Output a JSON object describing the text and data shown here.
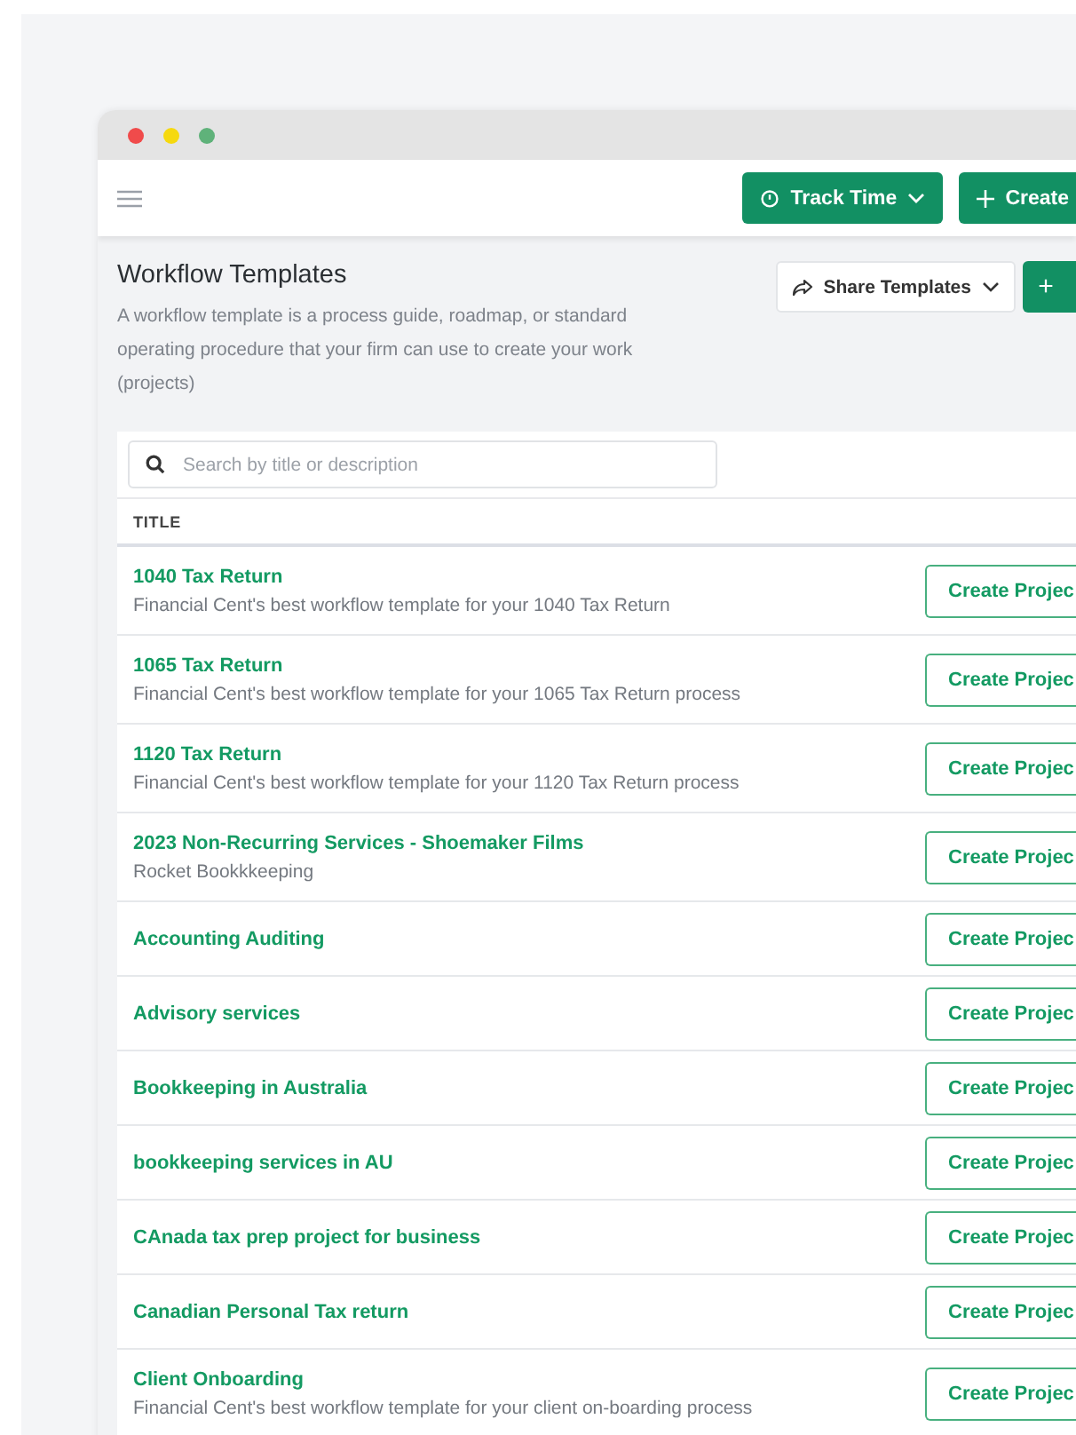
{
  "header": {
    "track_time": "Track Time",
    "create": "Create"
  },
  "page": {
    "title": "Workflow Templates",
    "description": "A workflow template is a process guide, roadmap, or standard operating procedure that your firm can use to create your work (projects)",
    "share": "Share Templates",
    "add": "+"
  },
  "search": {
    "placeholder": "Search by title or description"
  },
  "table": {
    "columns": [
      "TITLE"
    ],
    "rows": [
      {
        "title": "1040 Tax Return",
        "description": "Financial Cent's best workflow template for your 1040 Tax Return",
        "action": "Create Projec"
      },
      {
        "title": "1065 Tax Return",
        "description": "Financial Cent's best workflow template for your 1065 Tax Return process",
        "action": "Create Projec"
      },
      {
        "title": "1120 Tax Return",
        "description": "Financial Cent's best workflow template for your 1120 Tax Return process",
        "action": "Create Projec"
      },
      {
        "title": "2023 Non-Recurring Services - Shoemaker Films",
        "description": "Rocket Bookkkeeping",
        "action": "Create Projec"
      },
      {
        "title": "Accounting Auditing",
        "action": "Create Projec"
      },
      {
        "title": "Advisory services",
        "action": "Create Projec"
      },
      {
        "title": "Bookkeeping in Australia",
        "action": "Create Projec"
      },
      {
        "title": "bookkeeping services in AU",
        "action": "Create Projec"
      },
      {
        "title": "CAnada tax prep project for business",
        "action": "Create Projec"
      },
      {
        "title": "Canadian Personal Tax return",
        "action": "Create Projec"
      },
      {
        "title": "Client Onboarding",
        "description": "Financial Cent's best workflow template for your client on-boarding process",
        "action": "Create Projec"
      }
    ]
  }
}
